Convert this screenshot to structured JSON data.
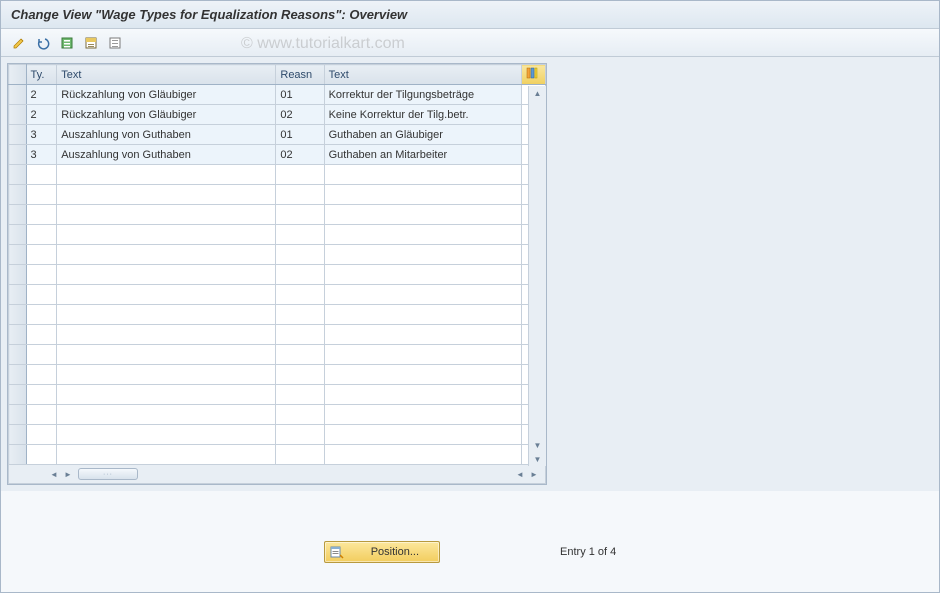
{
  "title": "Change View \"Wage Types for Equalization Reasons\": Overview",
  "watermark": "© www.tutorialkart.com",
  "toolbar": {
    "icons": [
      "edit",
      "undo",
      "select-all",
      "select-block",
      "deselect"
    ]
  },
  "table": {
    "columns": {
      "ty": "Ty.",
      "text1": "Text",
      "reasn": "Reasn",
      "text2": "Text"
    },
    "rows": [
      {
        "ty": "2",
        "text1": "Rückzahlung von Gläubiger",
        "reasn": "01",
        "text2": "Korrektur der Tilgungsbeträge"
      },
      {
        "ty": "2",
        "text1": "Rückzahlung von Gläubiger",
        "reasn": "02",
        "text2": "Keine Korrektur der Tilg.betr."
      },
      {
        "ty": "3",
        "text1": "Auszahlung von Guthaben",
        "reasn": "01",
        "text2": "Guthaben an Gläubiger"
      },
      {
        "ty": "3",
        "text1": "Auszahlung von Guthaben",
        "reasn": "02",
        "text2": "Guthaben an Mitarbeiter"
      }
    ],
    "empty_rows": 15
  },
  "footer": {
    "position_label": "Position...",
    "entry_text": "Entry 1 of 4"
  }
}
